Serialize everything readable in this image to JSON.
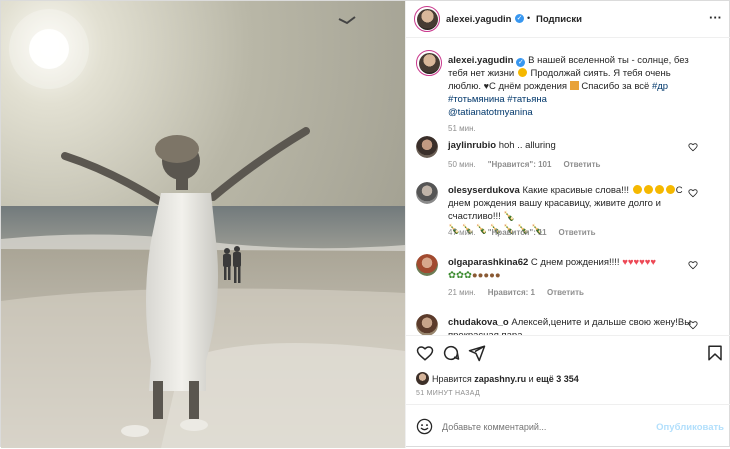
{
  "header": {
    "username": "alexei.yagudin",
    "verified_mark": "✓",
    "separator": "•",
    "follow_status": "Подписки",
    "more": "···"
  },
  "caption": {
    "username": "alexei.yagudin",
    "text_part1": " В нашей вселенной ты - солнце, без тебя нет жизни ",
    "text_part2": " Продолжай сиять. Я тебя очень люблю. ",
    "text_part3": "С днём рождения ",
    "text_part4": " Спасибо за всё ",
    "tags": "#др #тотьмянина #татьяна",
    "mention": "@tatianatotmyanina",
    "time": "51 мин."
  },
  "comments": [
    {
      "username": "jaylinrubio",
      "text": "hoh .. alluring",
      "time": "50 мин.",
      "likes": "\"Нравится\": 101",
      "reply": "Ответить"
    },
    {
      "username": "olesyserdukova",
      "text_before": "Какие красивые слова!!! ",
      "text_after": "С днем рождения вашу красавицу, живите долго и счастливо!!! ",
      "time": "47 мин.",
      "likes": "\"Нравится\": 11",
      "reply": "Ответить"
    },
    {
      "username": "olgaparashkina62",
      "text": "С днем рождения!!!!",
      "time": "21 мин.",
      "likes": "Нравится: 1",
      "reply": "Ответить"
    },
    {
      "username": "chudakova_o",
      "text": "Алексей,цените и дальше свою жену!Вы прекрасная пара"
    }
  ],
  "footer": {
    "liked_by_prefix": "Нравится ",
    "liked_by_user": "zapashny.ru",
    "liked_by_suffix": " и ",
    "others": "ещё 3 354",
    "post_time": "51 МИНУТ НАЗАД",
    "comment_placeholder": "Добавьте комментарий...",
    "publish": "Опубликовать"
  },
  "icons": [
    "heart-icon",
    "comment-icon",
    "share-icon",
    "bookmark-icon",
    "emoji-icon",
    "more-icon"
  ],
  "colors": {
    "link": "#00376b",
    "verified": "#3897f0",
    "like": "#ed4956",
    "publish_disabled": "#b2dffc",
    "muted": "#8e8e8e"
  }
}
